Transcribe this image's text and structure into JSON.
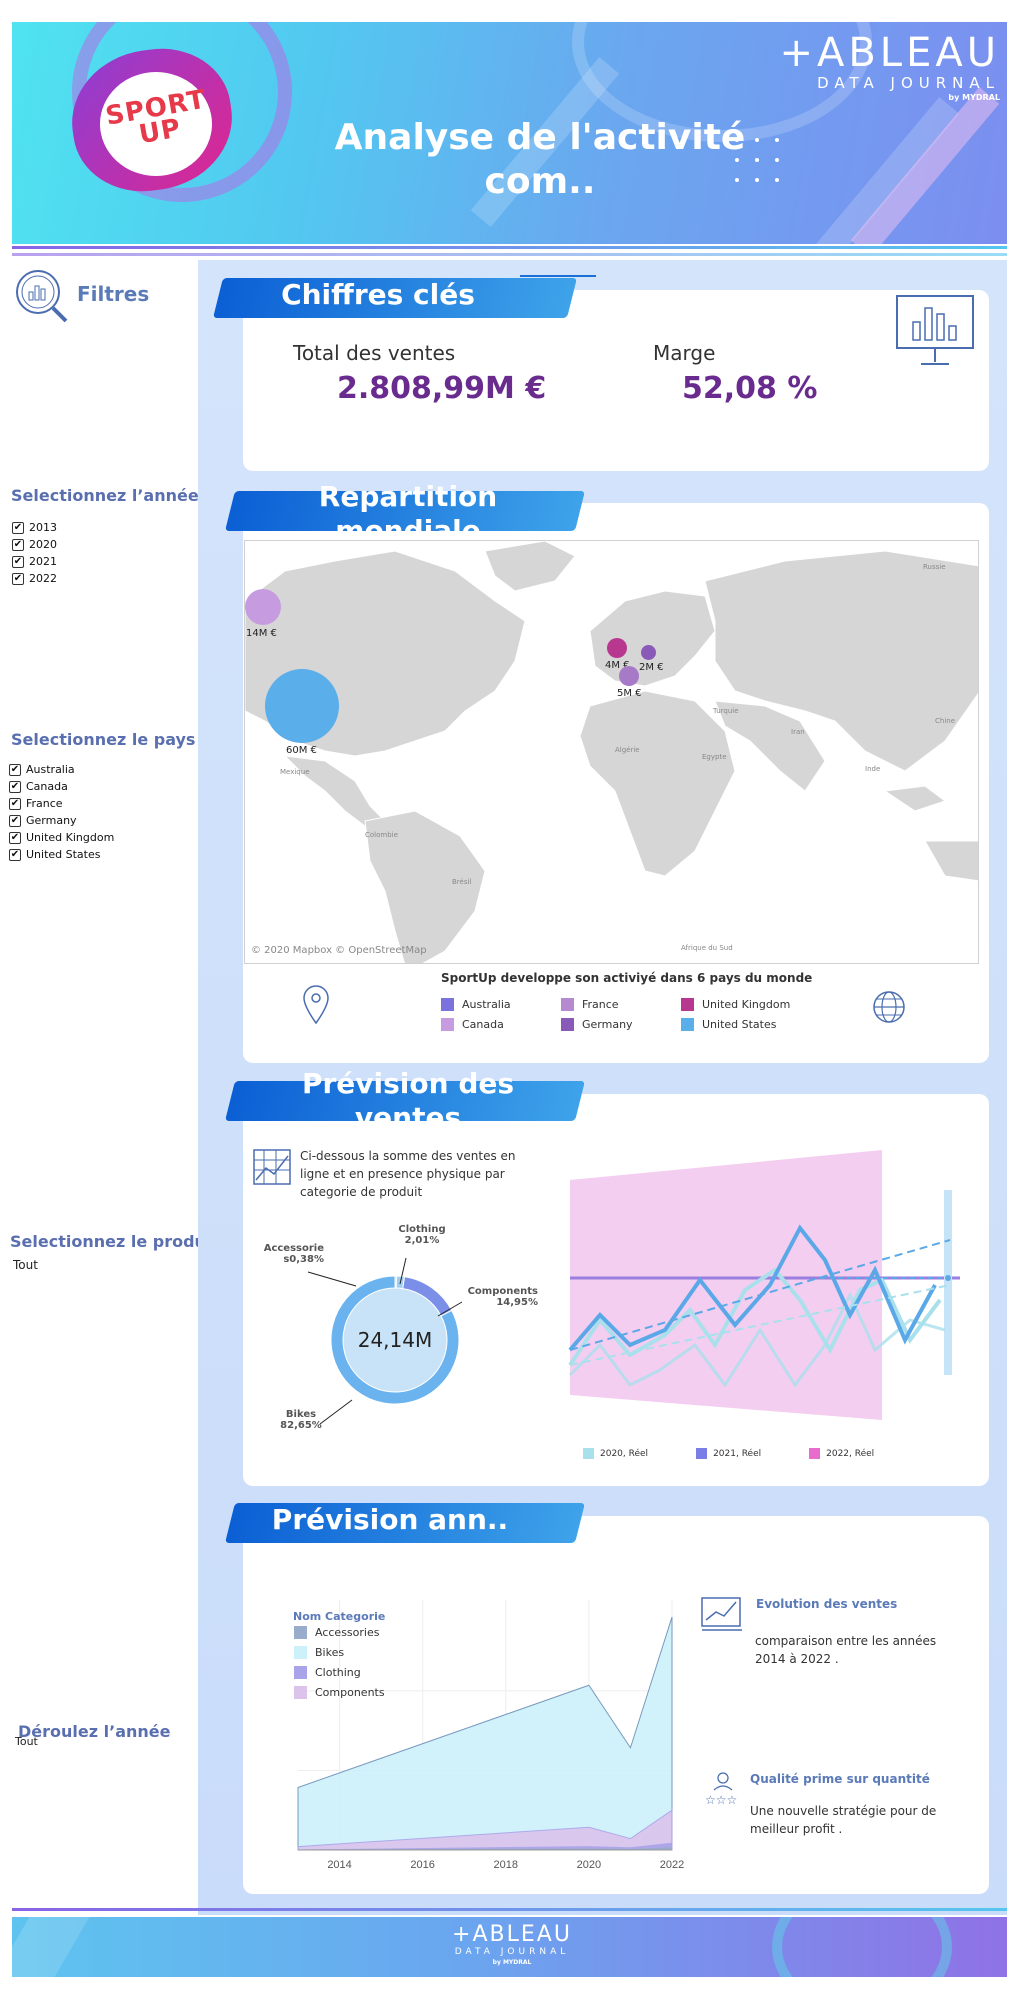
{
  "header": {
    "title": "Analyse de l'activité com..",
    "logo_text": "SPORT UP",
    "brand_name": "+ABLEAU",
    "brand_sub": "DATA JOURNAL",
    "brand_by": "by MYDRAL"
  },
  "sidebar": {
    "filters_title": "Filtres",
    "year_title": "Selectionnez l’année",
    "years": [
      "2013",
      "2020",
      "2021",
      "2022"
    ],
    "country_title": "Selectionnez le pays",
    "countries": [
      "Australia",
      "Canada",
      "France",
      "Germany",
      "United Kingdom",
      "United States"
    ],
    "product_title": "Selectionnez le produit",
    "product_value": "Tout",
    "scroll_year_title": "Déroulez l’année",
    "scroll_year_value": "Tout"
  },
  "kpi": {
    "banner": "Chiffres clés",
    "sales_label": "Total des ventes",
    "sales_value": "2.808,99M €",
    "margin_label": "Marge",
    "margin_value": "52,08 %"
  },
  "map": {
    "banner": "Repartition mondiale",
    "attribution": "© 2020 Mapbox © OpenStreetMap",
    "caption": "SportUp developpe son activiyé dans 6 pays du monde",
    "bubbles": [
      {
        "label": "14M €",
        "color": "#c79be0"
      },
      {
        "label": "60M €",
        "color": "#5aaeea"
      },
      {
        "label": "4M €",
        "color": "#b8378f"
      },
      {
        "label": "5M €",
        "color": "#a77ac8"
      },
      {
        "label": "2M €",
        "color": "#8a5ab8"
      }
    ],
    "place_labels": [
      "Russie",
      "Turquie",
      "Algérie",
      "Egypte",
      "Iran",
      "Inde",
      "Chine",
      "Mexique",
      "Colombie",
      "Brésil",
      "Afrique du Sud"
    ],
    "legend": [
      {
        "label": "Australia",
        "color": "#7b72de"
      },
      {
        "label": "France",
        "color": "#b58ad0"
      },
      {
        "label": "United Kingdom",
        "color": "#b8378f"
      },
      {
        "label": "Canada",
        "color": "#c79be0"
      },
      {
        "label": "Germany",
        "color": "#8a5ab8"
      },
      {
        "label": "United States",
        "color": "#5aaeea"
      }
    ]
  },
  "forecast": {
    "banner": "Prévision des ventes",
    "description": "Ci-dessous la somme des ventes en ligne et en presence physique par categorie de produit",
    "donut_center": "24,14M",
    "donut": [
      {
        "label": "Accessorie",
        "value_label": "s0,38%",
        "color": "#bcd9f5"
      },
      {
        "label": "Clothing",
        "value_label": "2,01%",
        "color": "#9fd0f2"
      },
      {
        "label": "Components",
        "value_label": "14,95%",
        "color": "#7b8fe8"
      },
      {
        "label": "Bikes",
        "value_label": "82,65%",
        "color": "#6ab3ee"
      }
    ],
    "legend": [
      {
        "label": "2020, Réel",
        "color": "#a9e0ec"
      },
      {
        "label": "2021, Réel",
        "color": "#7a7ee6"
      },
      {
        "label": "2022, Réel",
        "color": "#e86ccc"
      }
    ]
  },
  "annual": {
    "banner": "Prévision ann..",
    "legend_title": "Nom Categorie",
    "categories": [
      {
        "label": "Accessories",
        "color": "#9aaccc"
      },
      {
        "label": "Bikes",
        "color": "#cdf1fb"
      },
      {
        "label": "Clothing",
        "color": "#a9a4ea"
      },
      {
        "label": "Components",
        "color": "#dcc3ec"
      }
    ],
    "evolution_title": "Evolution des ventes",
    "evolution_text": "comparaison entre les années 2014 à 2022 .",
    "quality_title": "Qualité prime sur quantité",
    "quality_text": "Une nouvelle stratégie pour de meilleur profit ."
  },
  "chart_data": [
    {
      "type": "pie",
      "categories": [
        "Accessories",
        "Clothing",
        "Components",
        "Bikes"
      ],
      "values": [
        0.38,
        2.01,
        14.95,
        82.65
      ],
      "center_label": "24,14M"
    },
    {
      "type": "area",
      "x": [
        2013,
        2020,
        2021,
        2022
      ],
      "series": [
        {
          "name": "Bikes",
          "values": [
            0.55,
            1.45,
            0.9,
            2.05
          ]
        },
        {
          "name": "Components",
          "values": [
            0.03,
            0.2,
            0.1,
            0.35
          ]
        },
        {
          "name": "Clothing",
          "values": [
            0.0,
            0.03,
            0.02,
            0.06
          ]
        },
        {
          "name": "Accessories",
          "values": [
            0.0,
            0.01,
            0.005,
            0.02
          ]
        }
      ],
      "x_ticks": [
        "2014",
        "2016",
        "2018",
        "2020",
        "2022"
      ]
    }
  ]
}
